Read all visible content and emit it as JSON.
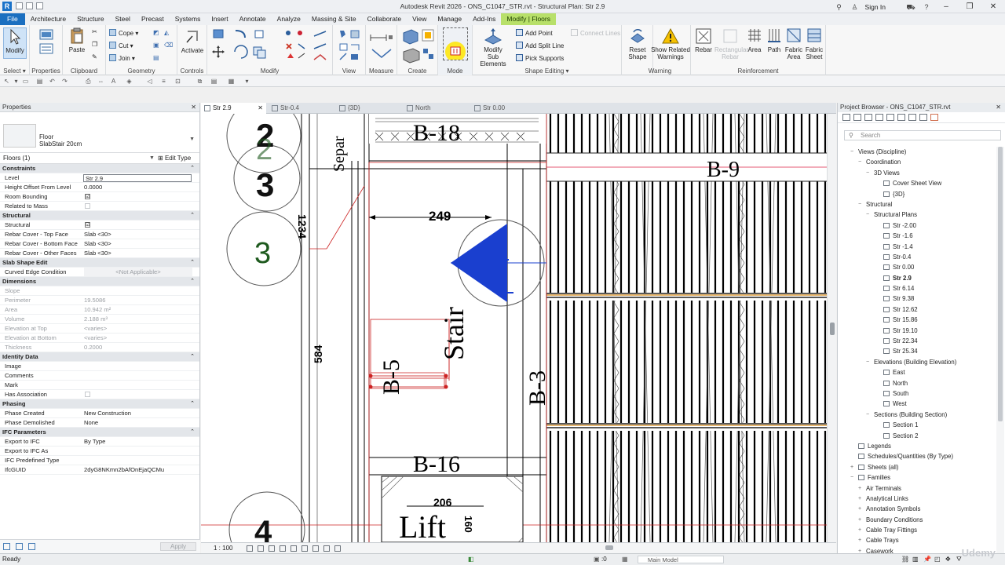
{
  "window": {
    "app_icon": "R",
    "title": "Autodesk Revit 2026  -  ONS_C1047_STR.rvt - Structural Plan: Str 2.9",
    "sign_in": "Sign In"
  },
  "tabs": [
    "File",
    "Architecture",
    "Structure",
    "Steel",
    "Precast",
    "Systems",
    "Insert",
    "Annotate",
    "Analyze",
    "Massing & Site",
    "Collaborate",
    "View",
    "Manage",
    "Add-Ins",
    "Modify | Floors"
  ],
  "ribbon": {
    "modify_label": "Modify",
    "select_label": "Select ▾",
    "paste_label": "Paste",
    "clipboard_label": "Clipboard",
    "cope_label": "Cope ▾",
    "cut_label": "Cut ▾",
    "join_label": "Join ▾",
    "geometry_label": "Geometry",
    "activate_label": "Activate",
    "controls_label": "Controls",
    "properties_label": "Properties",
    "modify_panel_label": "Modify",
    "view_label": "View",
    "measure_label": "Measure",
    "create_label": "Create",
    "mode_label": "Mode",
    "modify_sub_l1": "Modify",
    "modify_sub_l2": "Sub Elements",
    "add_point": "Add Point",
    "add_split_line": "Add Split Line",
    "pick_supports": "Pick Supports",
    "connect_lines": "Connect Lines",
    "shape_editing_label": "Shape Editing ▾",
    "reset_shape_l1": "Reset",
    "reset_shape_l2": "Shape",
    "show_related_l1": "Show Related",
    "show_related_l2": "Warnings",
    "warning_label": "Warning",
    "rebar": "Rebar",
    "rect_rebar_l1": "Rectangular",
    "rect_rebar_l2": "Rebar",
    "area": "Area",
    "path": "Path",
    "fabric_area_l1": "Fabric",
    "fabric_area_l2": "Area",
    "fabric_sheet_l1": "Fabric",
    "fabric_sheet_l2": "Sheet",
    "reinforcement_label": "Reinforcement"
  },
  "properties": {
    "title": "Properties",
    "type_family": "Floor",
    "type_name": "SlabStair 20cm",
    "filter": "Floors (1)",
    "edit_type": "Edit Type",
    "rows": [
      {
        "kind": "sec",
        "k": "Constraints"
      },
      {
        "kind": "edit",
        "k": "Level",
        "v": "Str 2.9"
      },
      {
        "kind": "row",
        "k": "Height Offset From Level",
        "v": "0.0000"
      },
      {
        "kind": "cb",
        "k": "Room Bounding",
        "v": "☑"
      },
      {
        "kind": "cbdim",
        "k": "Related to Mass",
        "v": ""
      },
      {
        "kind": "sec",
        "k": "Structural"
      },
      {
        "kind": "cb",
        "k": "Structural",
        "v": "☑"
      },
      {
        "kind": "row",
        "k": "Rebar Cover - Top Face",
        "v": "Slab <30>"
      },
      {
        "kind": "row",
        "k": "Rebar Cover - Bottom Face",
        "v": "Slab <30>"
      },
      {
        "kind": "row",
        "k": "Rebar Cover - Other Faces",
        "v": "Slab <30>"
      },
      {
        "kind": "sec",
        "k": "Slab Shape Edit"
      },
      {
        "kind": "center",
        "k": "Curved Edge Condition",
        "v": "<Not Applicable>"
      },
      {
        "kind": "sec",
        "k": "Dimensions"
      },
      {
        "kind": "grey",
        "k": "Slope",
        "v": ""
      },
      {
        "kind": "grey",
        "k": "Perimeter",
        "v": "19.5086"
      },
      {
        "kind": "grey",
        "k": "Area",
        "v": "10.942 m²"
      },
      {
        "kind": "grey",
        "k": "Volume",
        "v": "2.188 m³"
      },
      {
        "kind": "grey",
        "k": "Elevation at Top",
        "v": "<varies>"
      },
      {
        "kind": "grey",
        "k": "Elevation at Bottom",
        "v": "<varies>"
      },
      {
        "kind": "grey",
        "k": "Thickness",
        "v": "0.2000"
      },
      {
        "kind": "sec",
        "k": "Identity Data"
      },
      {
        "kind": "row",
        "k": "Image",
        "v": ""
      },
      {
        "kind": "row",
        "k": "Comments",
        "v": ""
      },
      {
        "kind": "row",
        "k": "Mark",
        "v": ""
      },
      {
        "kind": "cbdim",
        "k": "Has Association",
        "v": ""
      },
      {
        "kind": "sec",
        "k": "Phasing"
      },
      {
        "kind": "row",
        "k": "Phase Created",
        "v": "New Construction"
      },
      {
        "kind": "row",
        "k": "Phase Demolished",
        "v": "None"
      },
      {
        "kind": "sec",
        "k": "IFC Parameters"
      },
      {
        "kind": "row",
        "k": "Export to IFC",
        "v": "By Type"
      },
      {
        "kind": "row",
        "k": "Export to IFC As",
        "v": ""
      },
      {
        "kind": "row",
        "k": "IFC Predefined Type",
        "v": ""
      },
      {
        "kind": "row",
        "k": "IfcGUID",
        "v": "2dyG8NKmn2bAfOnEjaQCMu"
      }
    ],
    "apply": "Apply"
  },
  "view_tabs": [
    {
      "label": "Str 2.9",
      "active": true
    },
    {
      "label": "Str-0.4",
      "active": false
    },
    {
      "label": "{3D}",
      "active": false
    },
    {
      "label": "North",
      "active": false
    },
    {
      "label": "Str 0.00",
      "active": false
    }
  ],
  "drawing": {
    "grid_2": "2",
    "grid_3": "3",
    "grid_3b": "3",
    "grid_4": "4",
    "b18": "B-18",
    "b9": "B-9",
    "b5": "B-5",
    "b3": "B-3",
    "b16": "B-16",
    "dim_249": "249",
    "dim_1234": "1234",
    "dim_584": "584",
    "dim_206": "206",
    "dim_160": "160",
    "stair": "Stair",
    "lift": "Lift",
    "separ": "Separ",
    "scale": "1 : 100"
  },
  "browser": {
    "title": "Project Browser - ONS_C1047_STR.rvt",
    "search_placeholder": "Search",
    "tree": [
      {
        "d": 0,
        "exp": "−",
        "ico": false,
        "label": "Views (Discipline)"
      },
      {
        "d": 1,
        "exp": "−",
        "ico": false,
        "label": "Coordination"
      },
      {
        "d": 2,
        "exp": "−",
        "ico": false,
        "label": "3D Views"
      },
      {
        "d": 3,
        "exp": "",
        "ico": true,
        "label": "Cover Sheet View"
      },
      {
        "d": 3,
        "exp": "",
        "ico": true,
        "label": "{3D}"
      },
      {
        "d": 1,
        "exp": "−",
        "ico": false,
        "label": "Structural"
      },
      {
        "d": 2,
        "exp": "−",
        "ico": false,
        "label": "Structural Plans"
      },
      {
        "d": 3,
        "exp": "",
        "ico": true,
        "label": "Str -2.00"
      },
      {
        "d": 3,
        "exp": "",
        "ico": true,
        "label": "Str -1.6"
      },
      {
        "d": 3,
        "exp": "",
        "ico": true,
        "label": "Str -1.4"
      },
      {
        "d": 3,
        "exp": "",
        "ico": true,
        "label": "Str-0.4"
      },
      {
        "d": 3,
        "exp": "",
        "ico": true,
        "label": "Str 0.00"
      },
      {
        "d": 3,
        "exp": "",
        "ico": true,
        "label": "Str 2.9",
        "bold": true
      },
      {
        "d": 3,
        "exp": "",
        "ico": true,
        "label": "Str 6.14"
      },
      {
        "d": 3,
        "exp": "",
        "ico": true,
        "label": "Str 9.38"
      },
      {
        "d": 3,
        "exp": "",
        "ico": true,
        "label": "Str 12.62"
      },
      {
        "d": 3,
        "exp": "",
        "ico": true,
        "label": "Str 15.86"
      },
      {
        "d": 3,
        "exp": "",
        "ico": true,
        "label": "Str 19.10"
      },
      {
        "d": 3,
        "exp": "",
        "ico": true,
        "label": "Str 22.34"
      },
      {
        "d": 3,
        "exp": "",
        "ico": true,
        "label": "Str 25.34"
      },
      {
        "d": 2,
        "exp": "−",
        "ico": false,
        "label": "Elevations (Building Elevation)"
      },
      {
        "d": 3,
        "exp": "",
        "ico": true,
        "label": "East"
      },
      {
        "d": 3,
        "exp": "",
        "ico": true,
        "label": "North"
      },
      {
        "d": 3,
        "exp": "",
        "ico": true,
        "label": "South"
      },
      {
        "d": 3,
        "exp": "",
        "ico": true,
        "label": "West"
      },
      {
        "d": 2,
        "exp": "−",
        "ico": false,
        "label": "Sections (Building Section)"
      },
      {
        "d": 3,
        "exp": "",
        "ico": true,
        "label": "Section 1"
      },
      {
        "d": 3,
        "exp": "",
        "ico": true,
        "label": "Section 2"
      },
      {
        "d": 0,
        "exp": "",
        "ico": true,
        "label": "Legends"
      },
      {
        "d": 0,
        "exp": "",
        "ico": true,
        "label": "Schedules/Quantities (By Type)"
      },
      {
        "d": 0,
        "exp": "+",
        "ico": true,
        "label": "Sheets (all)"
      },
      {
        "d": 0,
        "exp": "−",
        "ico": true,
        "label": "Families"
      },
      {
        "d": 1,
        "exp": "+",
        "ico": false,
        "label": "Air Terminals"
      },
      {
        "d": 1,
        "exp": "+",
        "ico": false,
        "label": "Analytical Links"
      },
      {
        "d": 1,
        "exp": "+",
        "ico": false,
        "label": "Annotation Symbols"
      },
      {
        "d": 1,
        "exp": "+",
        "ico": false,
        "label": "Boundary Conditions"
      },
      {
        "d": 1,
        "exp": "+",
        "ico": false,
        "label": "Cable Tray Fittings"
      },
      {
        "d": 1,
        "exp": "+",
        "ico": false,
        "label": "Cable Trays"
      },
      {
        "d": 1,
        "exp": "+",
        "ico": false,
        "label": "Casework"
      }
    ]
  },
  "status": {
    "ready": "Ready",
    "zero": ":0",
    "main_model": "Main Model",
    "watermark": "Udemy"
  },
  "colors": {
    "file_tab": "#1b6fc0",
    "context_tab": "#b8e06a",
    "highlight": "#ffe600",
    "section_marker": "#1a3fcf",
    "grid_text": "#1e5a1e"
  }
}
